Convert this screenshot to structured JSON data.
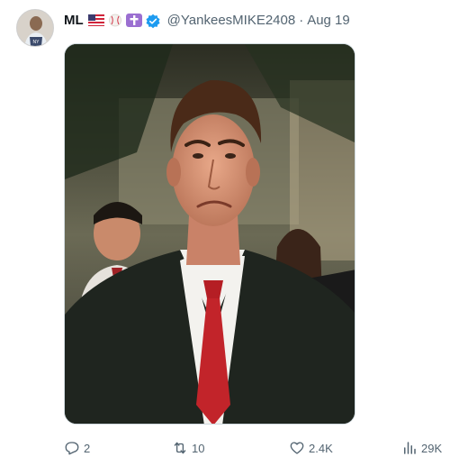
{
  "tweet": {
    "display_name": "ML",
    "handle": "@YankeesMIKE2408",
    "separator": "·",
    "date": "Aug 19",
    "media_alt": "Man in suit with red tie making a skeptical face"
  },
  "badges": [
    "us-flag-icon",
    "baseball-icon",
    "cross-icon",
    "verified-badge-icon"
  ],
  "actions": {
    "replies": "2",
    "retweets": "10",
    "likes": "2.4K",
    "views": "29K"
  },
  "colors": {
    "text_primary": "#0f1419",
    "text_secondary": "#536471",
    "verified_blue": "#1d9bf0",
    "cross_purple": "#9b6fd1",
    "border": "#cfd9de"
  }
}
